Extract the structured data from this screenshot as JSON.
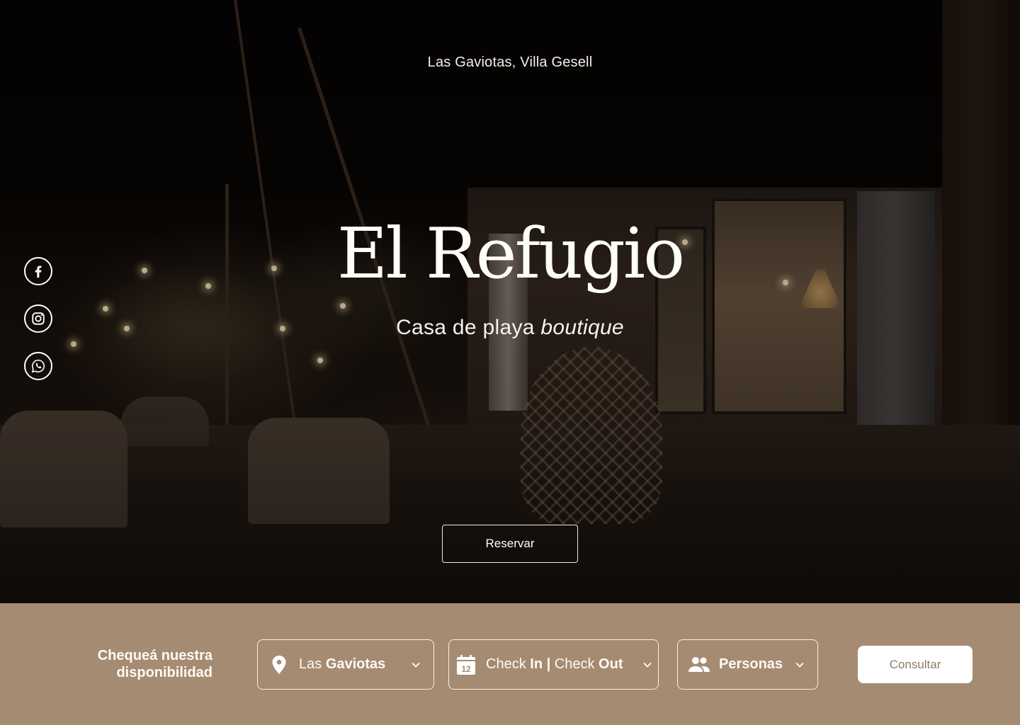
{
  "hero": {
    "location": "Las Gaviotas, Villa Gesell",
    "title": "El Refugio",
    "subtitle_regular": "Casa de playa",
    "subtitle_italic": "boutique",
    "reserve_label": "Reservar"
  },
  "socials": [
    {
      "name": "facebook",
      "icon": "facebook-icon"
    },
    {
      "name": "instagram",
      "icon": "instagram-icon"
    },
    {
      "name": "whatsapp",
      "icon": "whatsapp-icon"
    }
  ],
  "booking": {
    "label_line1": "Chequeá nuestra",
    "label_line2": "disponibilidad",
    "location_field": {
      "prefix": "Las",
      "value": "Gaviotas",
      "icon": "map-pin-icon"
    },
    "dates_field": {
      "check_in_prefix": "Check",
      "check_in": "In",
      "separator": "|",
      "check_out_prefix": "Check",
      "check_out": "Out",
      "icon": "calendar-icon",
      "icon_day": "12"
    },
    "people_field": {
      "value": "Personas",
      "icon": "people-icon"
    },
    "submit_label": "Consultar"
  },
  "colors": {
    "booking_bar": "#a58b72",
    "text_light": "#fffaf4",
    "button_text": "#8f7b6a"
  }
}
